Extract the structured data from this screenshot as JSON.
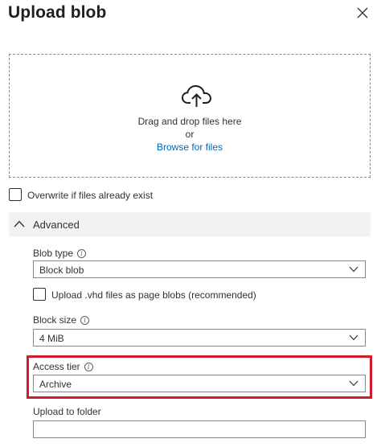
{
  "header": {
    "title": "Upload blob"
  },
  "dropzone": {
    "icon": "cloud-upload-icon",
    "drag_text": "Drag and drop files here",
    "or_text": "or",
    "browse_link": "Browse for files"
  },
  "overwrite": {
    "label": "Overwrite if files already exist",
    "checked": false
  },
  "advanced": {
    "label": "Advanced",
    "expanded": true
  },
  "blob_type": {
    "label": "Blob type",
    "value": "Block blob"
  },
  "vhd": {
    "label": "Upload .vhd files as page blobs (recommended)",
    "checked": false
  },
  "block_size": {
    "label": "Block size",
    "value": "4 MiB"
  },
  "access_tier": {
    "label": "Access tier",
    "value": "Archive"
  },
  "upload_folder": {
    "label": "Upload to folder",
    "value": ""
  },
  "colors": {
    "highlight": "#d11a2a",
    "link": "#0067b8",
    "advanced_bg": "#f3f2f1"
  }
}
